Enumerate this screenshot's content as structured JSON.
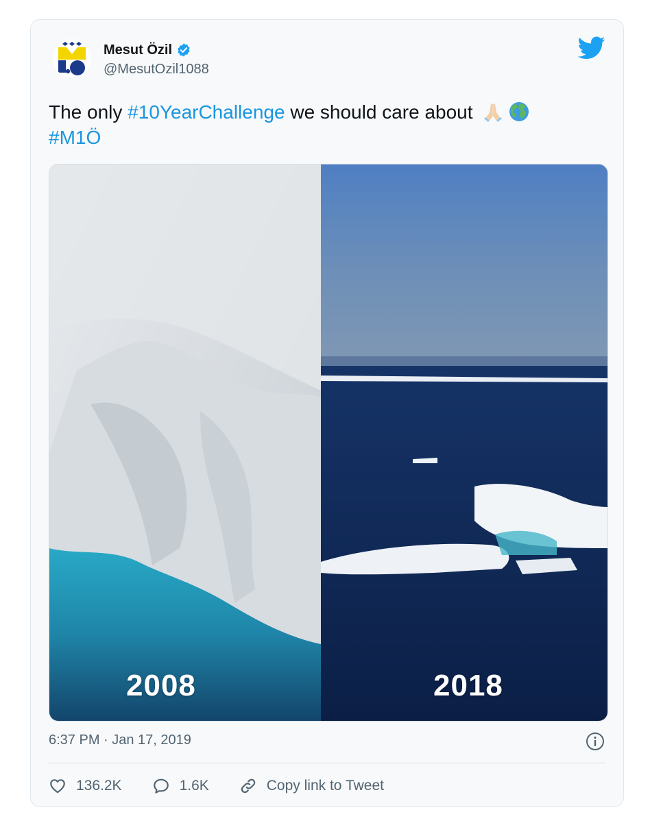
{
  "tweet": {
    "author": {
      "name": "Mesut Özil",
      "handle": "@MesutOzil1088"
    },
    "text": {
      "plain_1": "The only ",
      "hashtag_1": "#10YearChallenge",
      "plain_2": " we should care about",
      "hashtag_2": "#M1Ö",
      "emoji": [
        "folded-hands",
        "globe-africa-europe"
      ]
    },
    "media": {
      "left_label": "2008",
      "right_label": "2018"
    },
    "timestamp": "6:37 PM · Jan 17, 2019",
    "actions": {
      "likes": "136.2K",
      "replies": "1.6K",
      "copy_link": "Copy link to Tweet"
    }
  },
  "colors": {
    "accent": "#1da1f2",
    "hashtag": "#1b95e0",
    "muted": "#536471",
    "card_bg": "#f7f9fa"
  }
}
